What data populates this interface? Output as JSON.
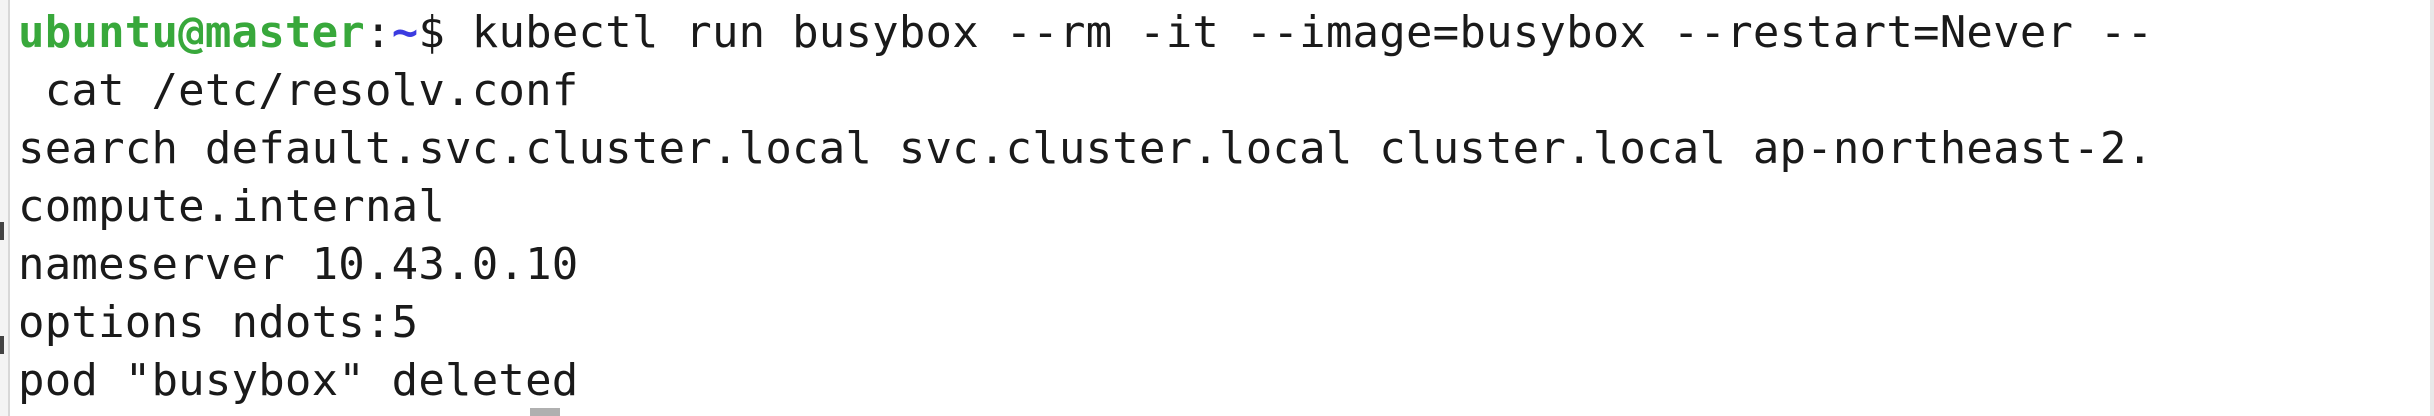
{
  "terminal": {
    "prompt": {
      "user_host": "ubuntu@master",
      "separator": ":",
      "path": "~",
      "symbol": "$ "
    },
    "command_line_1": "kubectl run busybox --rm -it --image=busybox --restart=Never --",
    "command_line_2": " cat /etc/resolv.conf",
    "output": [
      "search default.svc.cluster.local svc.cluster.local cluster.local ap-northeast-2.",
      "compute.internal",
      "nameserver 10.43.0.10",
      "options ndots:5",
      "pod \"busybox\" deleted"
    ]
  },
  "colors": {
    "background": "#ffffff",
    "text": "#1a1a1a",
    "user_host": "#38a83b",
    "path": "#3b3be0"
  }
}
